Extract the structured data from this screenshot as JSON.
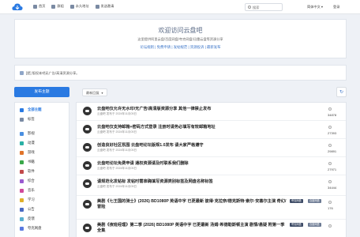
{
  "nav": {
    "items": [
      {
        "icon": "home-icon",
        "label": "首页"
      },
      {
        "icon": "group-icon",
        "label": "群组"
      },
      {
        "icon": "link-icon",
        "label": "永久地址"
      },
      {
        "icon": "chat-icon",
        "label": "发送邀请"
      }
    ],
    "search_placeholder": "搜索",
    "language": "简体中文 ▾",
    "login": "登录"
  },
  "hero": {
    "title": "欢迎访问云盘吧",
    "description": "这里提供阿里云盘/百度网盘/夸克网盘/迅雷云盘等资源分享",
    "links": "论坛规则 | 免费申请 | 发帖规范 | 资源投诉 | 最新发布"
  },
  "notice": {
    "text": "[提] 版权本吧无广告/高清资源分享。"
  },
  "publish_button": "发布主题",
  "sort_button": "最新回复",
  "sidebar": {
    "items": [
      {
        "label": "全部主题",
        "icon": "discussion-icon",
        "color": "#2a7ae2",
        "active": true
      },
      {
        "label": "标签",
        "icon": "tag-icon",
        "color": "#7a8aa3",
        "active": false
      },
      {
        "label": "影视",
        "icon": "film-icon",
        "color": "#4a8fe0",
        "active": false
      },
      {
        "label": "动漫",
        "icon": "tv-icon",
        "color": "#2ab0a5",
        "active": false
      },
      {
        "label": "游戏",
        "icon": "gamepad-icon",
        "color": "#e0742a",
        "active": false
      },
      {
        "label": "书籍",
        "icon": "book-icon",
        "color": "#3aa84a",
        "active": false
      },
      {
        "label": "软件",
        "icon": "tools-icon",
        "color": "#c24a4a",
        "active": false
      },
      {
        "label": "综合",
        "icon": "ellipsis-icon",
        "color": "#9a5ad0",
        "active": false
      },
      {
        "label": "音乐",
        "icon": "music-icon",
        "color": "#d04a9a",
        "active": false
      },
      {
        "label": "学习",
        "icon": "graduation-icon",
        "color": "#e0b02a",
        "active": false
      },
      {
        "label": "公告",
        "icon": "megaphone-icon",
        "color": "#4a6ac2",
        "active": false
      },
      {
        "label": "反馈",
        "icon": "feedback-icon",
        "color": "#5ab0d0",
        "active": false
      },
      {
        "label": "夸克网盘",
        "icon": "cloud-icon",
        "color": "#5a7ae0",
        "active": false
      }
    ]
  },
  "topics": [
    {
      "title": "云盘吧仅允许无水印/无广告/高清版资源分享 其他一律禁止发布",
      "meta": "云盘吧 发布于 2024年11月05日",
      "views": "34878",
      "tags": []
    },
    {
      "title": "云盘吧仅支持邮箱+密码方式登录 注册时请务必填写有效邮箱地址",
      "meta": "云盘吧 发布于 2024年11月05日",
      "views": "27393",
      "tags": []
    },
    {
      "title": "创造良好社区氛围 云盘吧论坛版规1.0发布 请大家严格遵守",
      "meta": "云盘吧 发布于 2024年11月05日",
      "views": "29891",
      "tags": []
    },
    {
      "title": "云盘吧论坛免费申请 通权资源请及时联系我们删除",
      "meta": "云盘吧 发布于 2024年11月05日",
      "views": "27971",
      "tags": []
    },
    {
      "title": "请规范化发帖标 发帖时需准确填写资源类别标签及网盘名称标签",
      "meta": "云盘吧 发布于 2024年11月05日",
      "views": "34444",
      "tags": []
    },
    {
      "title": "美剧《七王国的骑士》(2026) BD1080P 英语中字 已更最新 彼得·克拉奈/德克斯特·索尔·安塞尔主演 奇幻/冒险",
      "meta": "",
      "views": "176",
      "tags": [
        "夸克网盘",
        "百度网盘"
      ]
    },
    {
      "title": "美剧《夜班经理》第二季 (2026) BD1080P 英语中字 已更最新 汤姆·希德勒斯顿主演 剧情/悬疑 附第一季全集",
      "meta": "",
      "views": "",
      "tags": [
        "夸克网盘",
        "百度网盘"
      ]
    }
  ],
  "colors": {
    "accent": "#2a7ae2",
    "page_bg": "#eef1f6"
  }
}
